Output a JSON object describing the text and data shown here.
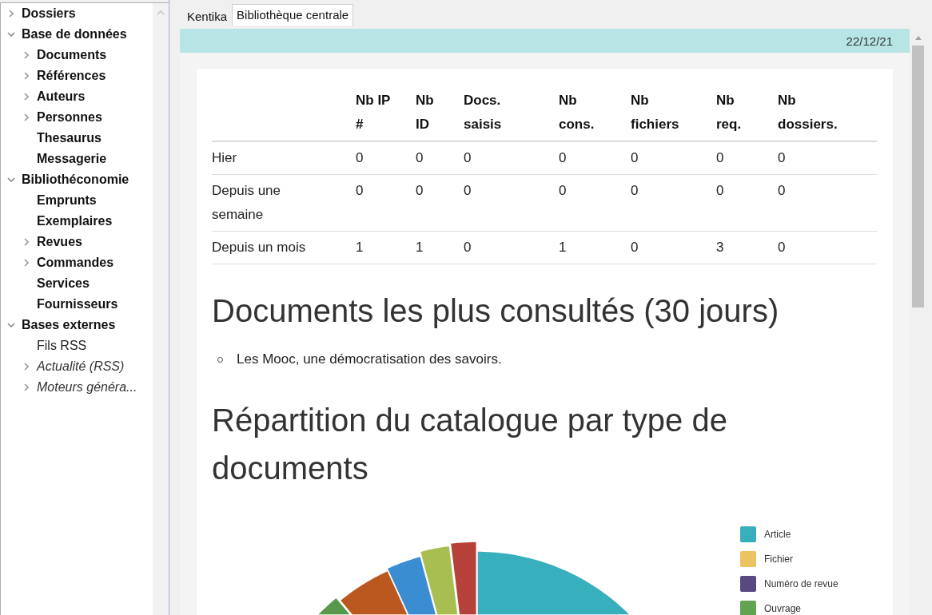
{
  "sidebar": {
    "items": [
      {
        "label": "Dossiers",
        "kind": "module",
        "expanded": false
      },
      {
        "label": "Base de données",
        "kind": "module",
        "expanded": true,
        "children": [
          {
            "label": "Documents",
            "kind": "module",
            "expanded": false
          },
          {
            "label": "Références",
            "kind": "module",
            "expanded": false
          },
          {
            "label": "Auteurs",
            "kind": "module",
            "expanded": false
          },
          {
            "label": "Personnes",
            "kind": "module",
            "expanded": false
          },
          {
            "label": "Thesaurus",
            "kind": "module"
          },
          {
            "label": "Messagerie",
            "kind": "module"
          }
        ]
      },
      {
        "label": "Bibliothéconomie",
        "kind": "module",
        "expanded": true,
        "children": [
          {
            "label": "Emprunts",
            "kind": "module"
          },
          {
            "label": "Exemplaires",
            "kind": "module"
          },
          {
            "label": "Revues",
            "kind": "module",
            "expanded": false
          },
          {
            "label": "Commandes",
            "kind": "module",
            "expanded": false
          },
          {
            "label": "Services",
            "kind": "module"
          },
          {
            "label": "Fournisseurs",
            "kind": "module"
          }
        ]
      },
      {
        "label": "Bases externes",
        "kind": "module",
        "expanded": true,
        "children": [
          {
            "label": "Fils RSS",
            "kind": "link"
          },
          {
            "label": "Actualité (RSS)",
            "kind": "external",
            "expanded": false
          },
          {
            "label": "Moteurs généra...",
            "kind": "external",
            "expanded": false
          }
        ]
      }
    ]
  },
  "tabs": [
    {
      "label": "Kentika",
      "selected": false
    },
    {
      "label": "Bibliothèque centrale",
      "selected": true
    }
  ],
  "header_bar": {
    "date": "22/12/21"
  },
  "stats_table": {
    "columns": [
      "Nb IP #",
      "Nb ID",
      "Docs. saisis",
      "Nb cons.",
      "Nb fichiers",
      "Nb req.",
      "Nb dossiers."
    ],
    "rows": [
      {
        "label": "Hier",
        "values": [
          "0",
          "0",
          "0",
          "0",
          "0",
          "0",
          "0"
        ]
      },
      {
        "label": "Depuis une semaine",
        "values": [
          "0",
          "0",
          "0",
          "0",
          "0",
          "0",
          "0"
        ]
      },
      {
        "label": "Depuis un mois",
        "values": [
          "1",
          "1",
          "0",
          "1",
          "0",
          "3",
          "0"
        ]
      }
    ]
  },
  "most_consulted": {
    "title": "Documents les plus consultés (30 jours)",
    "items": [
      "Les Mooc, une démocratisation des savoirs."
    ]
  },
  "catalogue": {
    "title": "Répartition du catalogue par type de documents",
    "legend": [
      {
        "label": "Article",
        "color": "#37afbd"
      },
      {
        "label": "Fichier",
        "color": "#ecc363"
      },
      {
        "label": "Numéro de revue",
        "color": "#584a80"
      },
      {
        "label": "Ouvrage",
        "color": "#62a352"
      }
    ]
  }
}
